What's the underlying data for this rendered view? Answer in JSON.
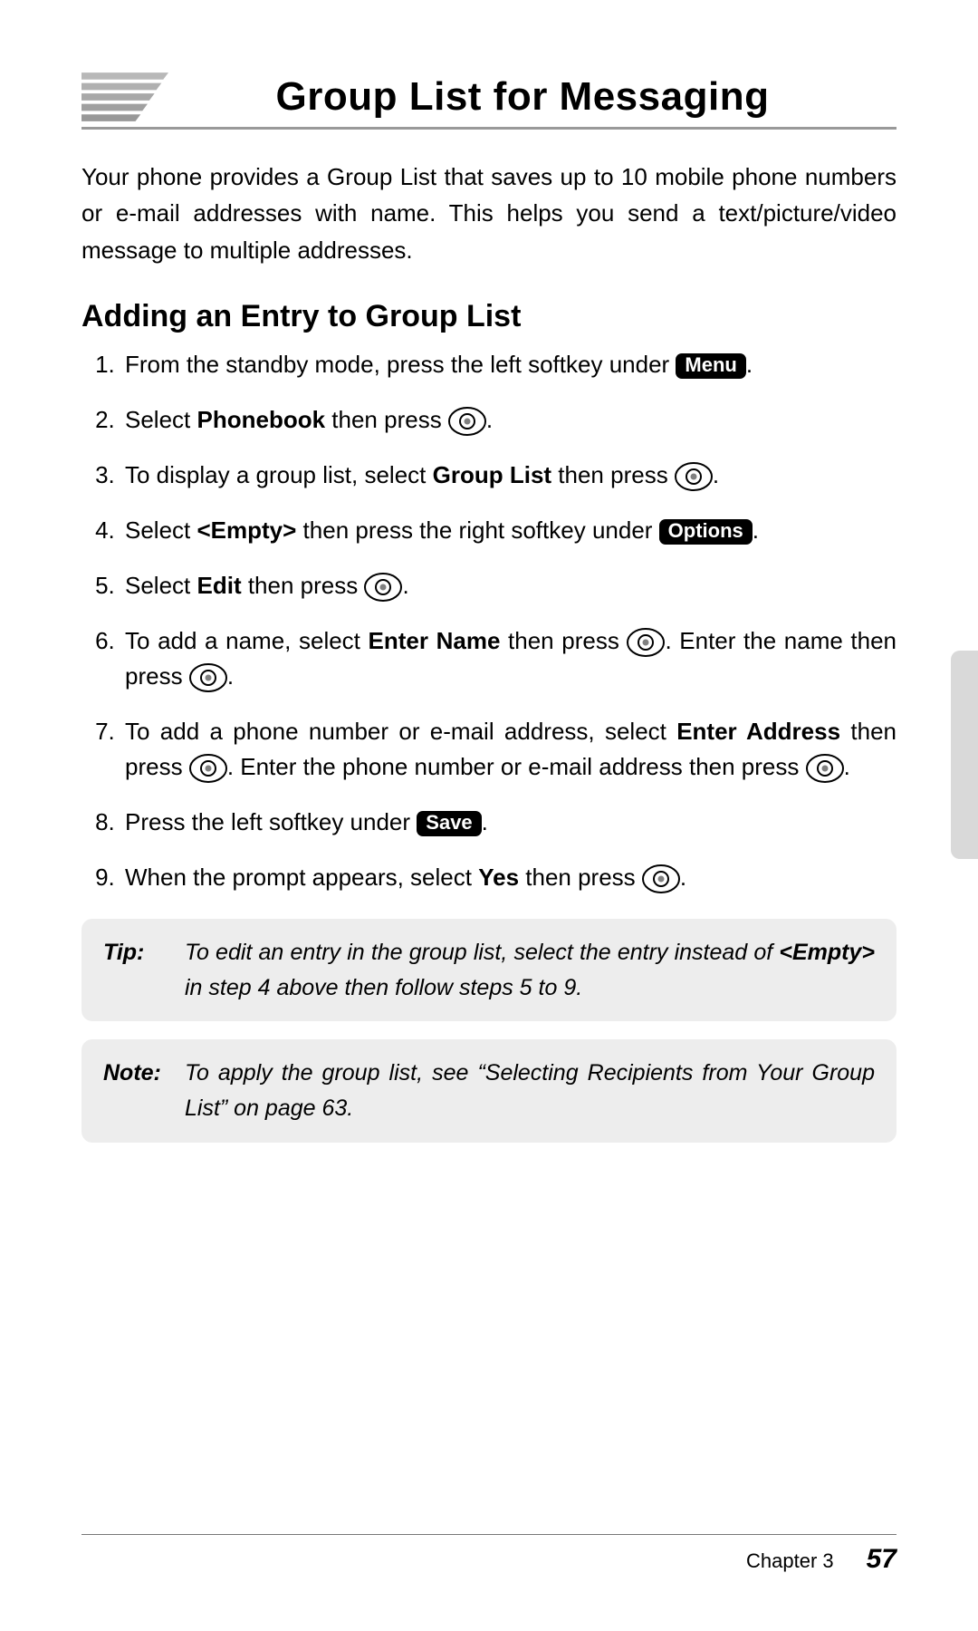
{
  "header": {
    "title": "Group List for Messaging"
  },
  "intro": "Your phone provides a Group List that saves up to 10 mobile phone numbers or e-mail addresses with name. This helps you send a text/picture/video message to multiple addresses.",
  "section_heading": "Adding an Entry to Group List",
  "keys": {
    "menu": "Menu",
    "options": "Options",
    "save": "Save"
  },
  "bold": {
    "phonebook": "Phonebook",
    "group_list": "Group List",
    "empty": "<Empty>",
    "edit": "Edit",
    "enter_name": "Enter Name",
    "enter_address": "Enter Address",
    "yes": "Yes"
  },
  "steps": {
    "s1a": "From the standby mode, press the left softkey under ",
    "s1b": ".",
    "s2a": "Select ",
    "s2b": " then press ",
    "s2c": ".",
    "s3a": "To display a group list, select ",
    "s3b": " then press ",
    "s3c": ".",
    "s4a": "Select ",
    "s4b": " then press the right softkey under ",
    "s4c": ".",
    "s5a": "Select ",
    "s5b": " then press ",
    "s5c": ".",
    "s6a": "To add a name, select ",
    "s6b": " then press ",
    "s6c": ". Enter the name then press ",
    "s6d": ".",
    "s7a": "To add a phone number or e-mail address, select ",
    "s7b": " then press ",
    "s7c": ". Enter the phone number or e-mail address then press ",
    "s7d": ".",
    "s8a": "Press the left softkey under ",
    "s8b": ".",
    "s9a": "When the prompt appears, select ",
    "s9b": " then press ",
    "s9c": "."
  },
  "tip": {
    "label": "Tip:",
    "body_a": "To edit an entry in the group list, select the entry instead of ",
    "body_bold": "<Empty>",
    "body_b": " in step 4 above then follow steps 5 to 9."
  },
  "note": {
    "label": "Note:",
    "body": "To apply the group list, see “Selecting Recipients from Your Group List” on page 63."
  },
  "footer": {
    "chapter": "Chapter 3",
    "page": "57"
  }
}
